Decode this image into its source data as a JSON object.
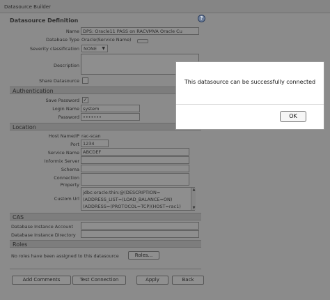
{
  "window": {
    "title": "Datasource Builder",
    "help_glyph": "?"
  },
  "form": {
    "heading": "Datasource Definition",
    "name_label": "Name",
    "name_value": "DPS: Oracle11 PASS on RACVMVA Oracle Cu",
    "dbtype_label": "Database Type",
    "dbtype_value": "Oracle(Service Name)",
    "severity_label": "Severity classification",
    "severity_value": "NONE",
    "description_label": "Description",
    "description_value": "",
    "share_label": "Share Datasource",
    "authentication_section": "Authentication",
    "save_password_label": "Save Password",
    "save_password_checked": "✓",
    "login_label": "Login Name",
    "login_value": "system",
    "password_label": "Password",
    "password_value": "•••••••",
    "location_section": "Location",
    "host_label": "Host Name/IP",
    "host_value": "rac-scan",
    "port_label": "Port",
    "port_value": "1234",
    "service_label": "Service Name",
    "service_value": "ABCDEF",
    "informix_label": "Informix Server",
    "informix_value": "",
    "schema_label": "Schema",
    "schema_value": "",
    "connection_label": "Connection",
    "connection_value": "",
    "property_label": "Property",
    "custom_url_label": "Custom Url",
    "custom_url_lines": [
      "jdbc:oracle:thin:@(DESCRIPTION=",
      "(ADDRESS_LIST=(LOAD_BALANCE=ON)",
      "(ADDRESS=(PROTOCOL=TCP)(HOST=rac1)"
    ],
    "cas_section": "CAS",
    "db_instance_account_label": "Database Instance Account",
    "db_instance_account_value": "",
    "db_instance_directory_label": "Database Instance Directory",
    "db_instance_directory_value": "",
    "roles_section": "Roles",
    "roles_text": "No roles have been assigned to this datasource",
    "roles_button": "Roles..."
  },
  "footer": {
    "add_comments": "Add Comments",
    "test_connection": "Test Connection",
    "apply": "Apply",
    "back": "Back"
  },
  "dialog": {
    "message": "This datasource can be successfully connected",
    "ok_label": "OK"
  }
}
